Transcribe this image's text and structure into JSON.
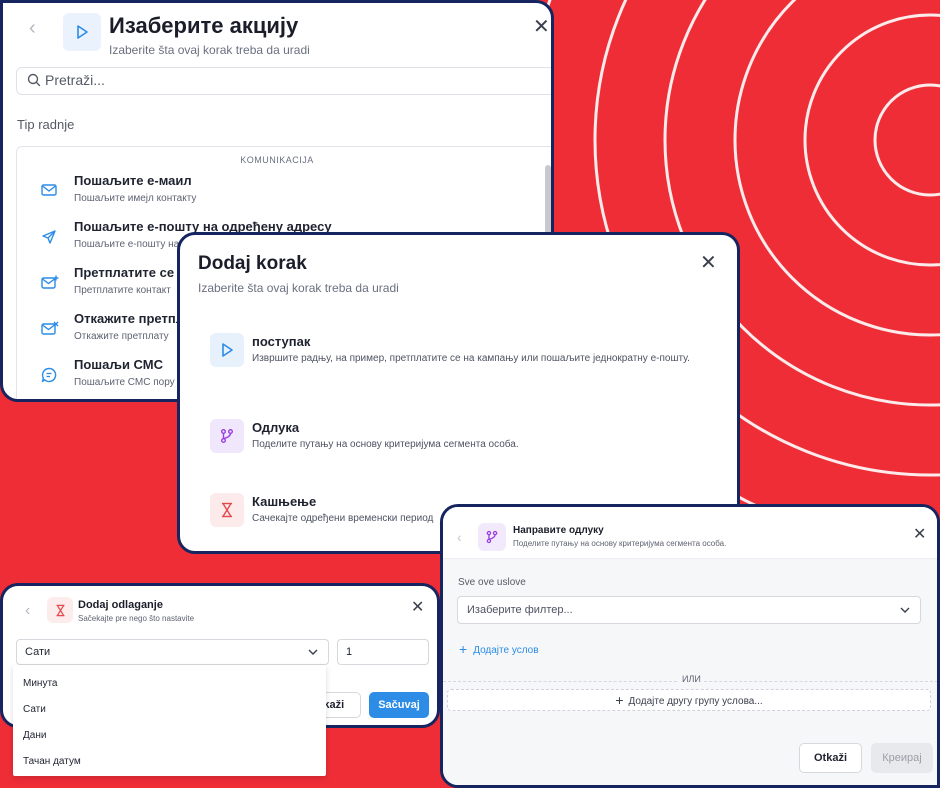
{
  "colors": {
    "background_red": "#ee2d37",
    "card_border": "#16245f",
    "primary": "#2c8ce6",
    "icon_blue": "#2c8ce6",
    "icon_purple": "#9b3fe0",
    "icon_red": "#e5484d"
  },
  "action_dialog": {
    "title": "Изаберите акцију",
    "subtitle": "Izaberite šta ovaj korak treba da uradi",
    "search_placeholder": "Pretraži...",
    "section_label": "Tip radnje",
    "category": "KOMUNIKACIJA",
    "items": [
      {
        "label": "Пошаљите е-маил",
        "desc": "Пошаљите имејл контакту",
        "icon": "mail-icon"
      },
      {
        "label": "Пошаљите е-пошту на одређену адресу",
        "desc": "Пошаљите е-пошту на",
        "icon": "send-icon"
      },
      {
        "label": "Претплатите се на",
        "desc": "Претплатите контакт",
        "icon": "mail-plus-icon"
      },
      {
        "label": "Откажите претпла",
        "desc": "Откажите претплату",
        "icon": "mail-x-icon"
      },
      {
        "label": "Пошаљи СМС",
        "desc": "Пошаљите СМС пору",
        "icon": "sms-icon"
      }
    ]
  },
  "step_dialog": {
    "title": "Dodaj korak",
    "subtitle": "Izaberite šta ovaj korak treba da uradi",
    "options": [
      {
        "label": "поступак",
        "desc": "Извршите радњу, на пример, претплатите се на кампању или пошаљите једнократну е-пошту.",
        "icon": "play-icon"
      },
      {
        "label": "Одлука",
        "desc": "Поделите путању на основу критеријума сегмента особа.",
        "icon": "branch-icon"
      },
      {
        "label": "Кашњење",
        "desc": "Сачекајте одређени временски период",
        "icon": "hourglass-icon"
      }
    ]
  },
  "delay_dialog": {
    "title": "Dodaj odlaganje",
    "subtitle": "Sačekajte pre nego što nastavite",
    "unit_value": "Сати",
    "amount_value": "1",
    "cancel_label": "Otkaži",
    "cancel_visible": "tkaži",
    "save_label": "Sačuvaj",
    "unit_options": [
      "Минута",
      "Сати",
      "Дани",
      "Тачан датум"
    ]
  },
  "decision_dialog": {
    "title": "Направите одлуку",
    "subtitle": "Поделите путању на основу критеријума сегмента особа.",
    "conditions_label": "Sve ove uslove",
    "filter_placeholder": "Изаберите филтер...",
    "add_condition": "Додајте услов",
    "or_label": "ИЛИ",
    "add_group": "Додајте другу групу услова...",
    "cancel_label": "Otkaži",
    "create_label": "Креирај"
  }
}
